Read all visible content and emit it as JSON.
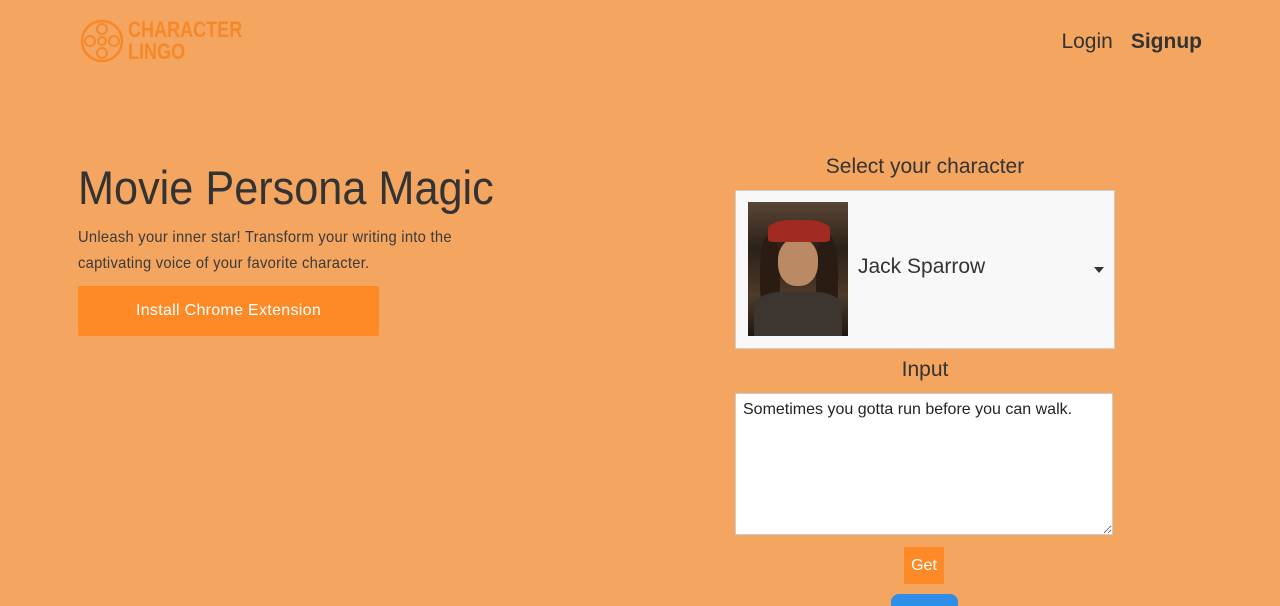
{
  "brand": {
    "line1": "CHARACTER",
    "line2": "LINGO",
    "color": "#f6882a"
  },
  "nav": {
    "login": "Login",
    "signup": "Signup"
  },
  "hero": {
    "title": "Movie Persona Magic",
    "subtitle": "Unleash your inner star! Transform your writing into the captivating voice of your favorite character.",
    "install_label": "Install Chrome Extension"
  },
  "panel": {
    "select_label": "Select your character",
    "selected_character": "Jack Sparrow",
    "input_label": "Input",
    "input_value": "Sometimes you gotta run before you can walk.",
    "get_label": "Get"
  },
  "colors": {
    "background": "#f4a55f",
    "accent": "#fd8a26",
    "badge": "#2f8fe8"
  }
}
